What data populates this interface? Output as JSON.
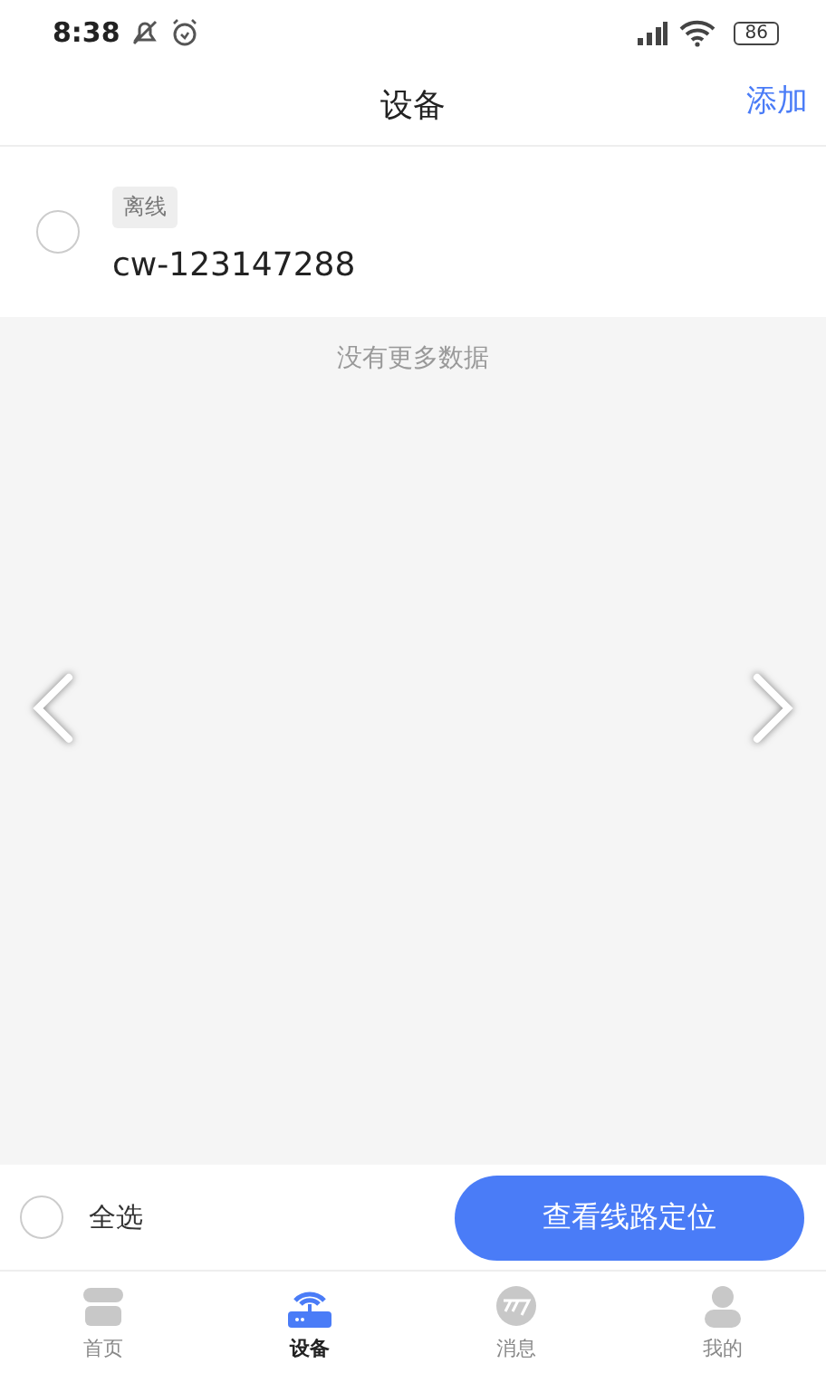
{
  "status_bar": {
    "time": "8:38",
    "battery": "86"
  },
  "header": {
    "title": "设备",
    "action": "添加"
  },
  "devices": [
    {
      "status": "离线",
      "name": "cw-123147288",
      "checked": false
    }
  ],
  "list_end": "没有更多数据",
  "footer": {
    "select_all": {
      "label": "全选",
      "checked": false
    },
    "button": "查看线路定位"
  },
  "tabs": [
    {
      "label": "首页",
      "kind": "home",
      "selected": false
    },
    {
      "label": "设备",
      "kind": "router",
      "selected": true
    },
    {
      "label": "消息",
      "kind": "message",
      "selected": false
    },
    {
      "label": "我的",
      "kind": "user",
      "selected": false
    }
  ]
}
